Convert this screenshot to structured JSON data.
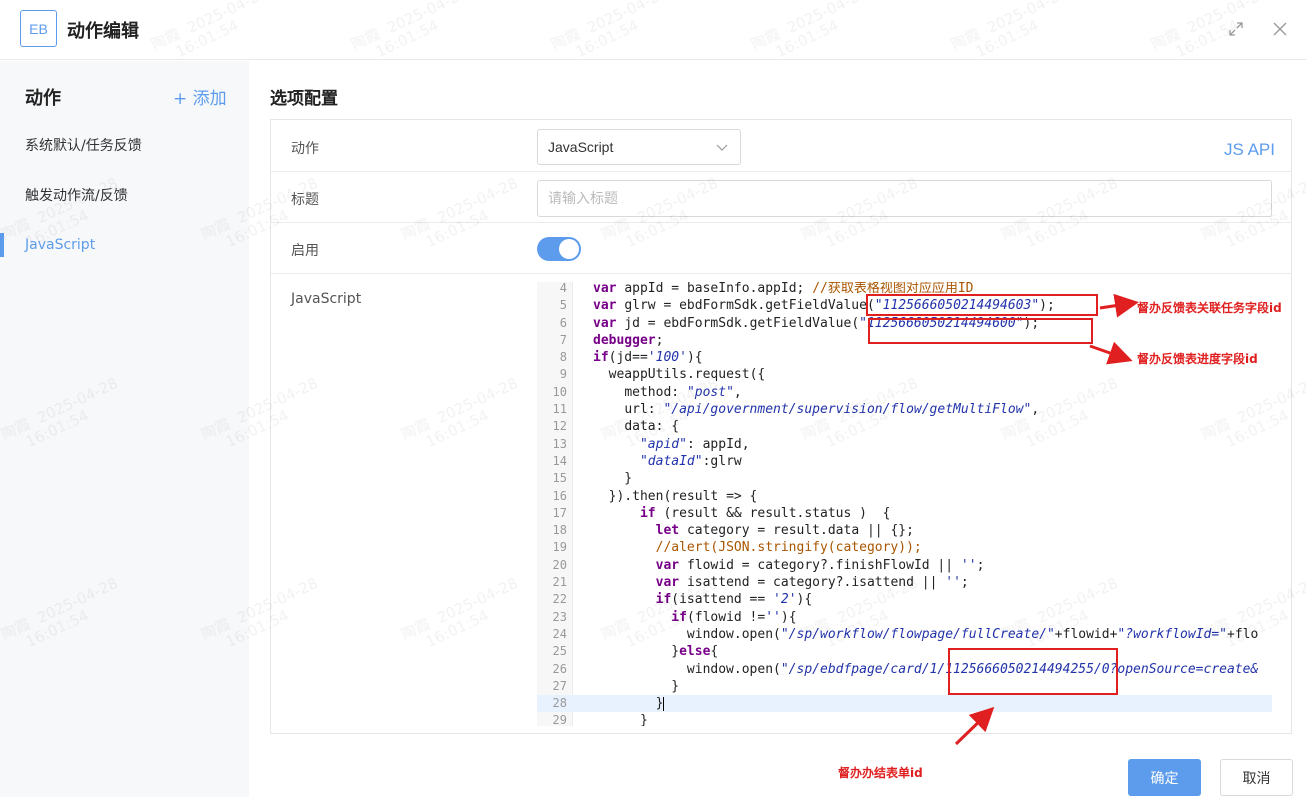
{
  "header": {
    "logo": "EB",
    "title": "动作编辑"
  },
  "sidebar": {
    "title": "动作",
    "add_label": "+ 添加",
    "items": [
      {
        "label": "系统默认/任务反馈"
      },
      {
        "label": "触发动作流/反馈"
      },
      {
        "label": "JavaScript"
      }
    ]
  },
  "main": {
    "section_title": "选项配置",
    "rows": {
      "action_label": "动作",
      "action_value": "JavaScript",
      "jsapi_link": "JS API",
      "title_label": "标题",
      "title_placeholder": "请输入标题",
      "enable_label": "启用",
      "enable_on": true,
      "script_label": "JavaScript"
    }
  },
  "code": {
    "lines": [
      {
        "n": "4",
        "t": "var appId = baseInfo.appId; //获取表格视图对应应用ID"
      },
      {
        "n": "5",
        "t": "var glrw = ebdFormSdk.getFieldValue(\"1125666050214494603\");"
      },
      {
        "n": "6",
        "t": "var jd = ebdFormSdk.getFieldValue(\"1125666050214494600\");"
      },
      {
        "n": "7",
        "t": "debugger;"
      },
      {
        "n": "8",
        "t": "if(jd=='100'){"
      },
      {
        "n": "9",
        "t": "  weappUtils.request({"
      },
      {
        "n": "10",
        "t": "    method: \"post\","
      },
      {
        "n": "11",
        "t": "    url: \"/api/government/supervision/flow/getMultiFlow\","
      },
      {
        "n": "12",
        "t": "    data: {"
      },
      {
        "n": "13",
        "t": "      \"apid\": appId,"
      },
      {
        "n": "14",
        "t": "      \"dataId\":glrw"
      },
      {
        "n": "15",
        "t": "    }"
      },
      {
        "n": "16",
        "t": "  }).then(result => {"
      },
      {
        "n": "17",
        "t": "      if (result && result.status )  {"
      },
      {
        "n": "18",
        "t": "        let category = result.data || {};"
      },
      {
        "n": "19",
        "t": "        //alert(JSON.stringify(category));"
      },
      {
        "n": "20",
        "t": "        var flowid = category?.finishFlowId || '';"
      },
      {
        "n": "21",
        "t": "        var isattend = category?.isattend || '';"
      },
      {
        "n": "22",
        "t": "        if(isattend == '2'){"
      },
      {
        "n": "23",
        "t": "          if(flowid !=''){"
      },
      {
        "n": "24",
        "t": "            window.open(\"/sp/workflow/flowpage/fullCreate/\"+flowid+\"?workflowId=\"+flo"
      },
      {
        "n": "25",
        "t": "          }else{"
      },
      {
        "n": "26",
        "t": "            window.open(\"/sp/ebdfpage/card/1/1125666050214494255/0?openSource=create&"
      },
      {
        "n": "27",
        "t": "          }"
      },
      {
        "n": "28",
        "t": "        }"
      },
      {
        "n": "29",
        "t": "      }"
      }
    ]
  },
  "annotations": [
    {
      "text": "督办反馈表关联任务字段id"
    },
    {
      "text": "督办反馈表进度字段id"
    },
    {
      "text": "督办办结表单id"
    }
  ],
  "footer": {
    "ok_label": "确定",
    "cancel_label": "取消"
  },
  "watermark": {
    "name": "陶霞",
    "date": "2025-04-28",
    "time": "16:01:54"
  },
  "colors": {
    "accent": "#5d9cec",
    "annotation": "#e02020"
  }
}
